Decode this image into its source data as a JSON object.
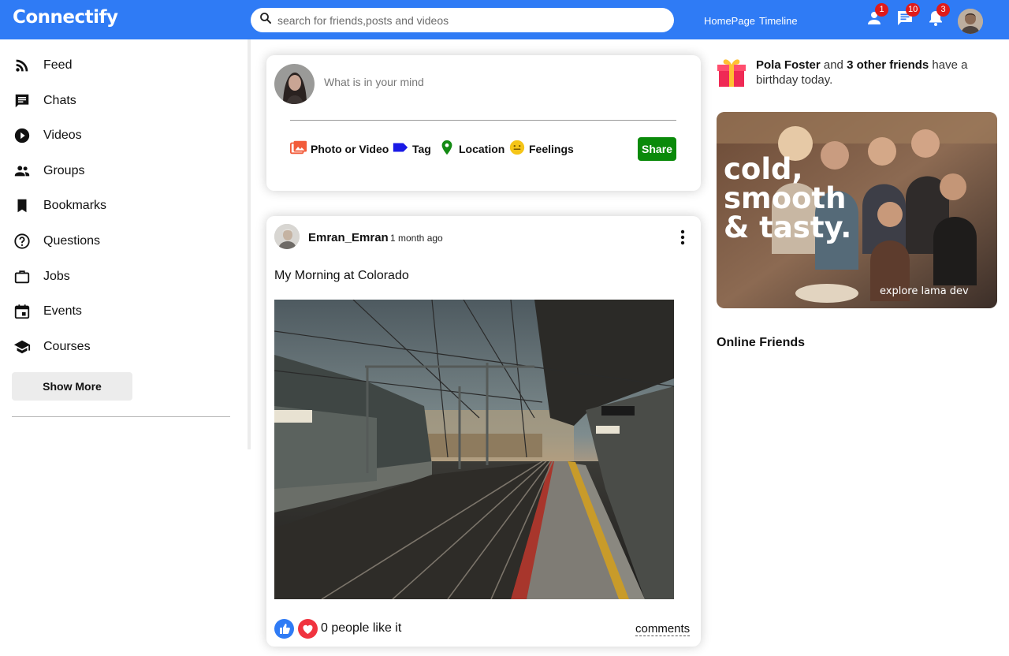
{
  "brand": {
    "logo_text": "Connectify",
    "accent_color": "#2f7bf5"
  },
  "search": {
    "placeholder": "search for friends,posts and videos",
    "icon": "search-icon"
  },
  "topbar": {
    "links": [
      "HomePage",
      "Timeline"
    ],
    "icons": [
      {
        "icon": "person-icon",
        "badge": "1"
      },
      {
        "icon": "chat-icon",
        "badge": "10"
      },
      {
        "icon": "bell-icon",
        "badge": "3"
      }
    ],
    "badge_color": "#e01a1a"
  },
  "sidebar": {
    "items": [
      {
        "label": "Feed",
        "icon": "rss-feed-icon"
      },
      {
        "label": "Chats",
        "icon": "chat-icon"
      },
      {
        "label": "Videos",
        "icon": "play-circle-icon"
      },
      {
        "label": "Groups",
        "icon": "group-icon"
      },
      {
        "label": "Bookmarks",
        "icon": "bookmark-icon"
      },
      {
        "label": "Questions",
        "icon": "help-circle-icon"
      },
      {
        "label": "Jobs",
        "icon": "briefcase-icon"
      },
      {
        "label": "Events",
        "icon": "calendar-icon"
      },
      {
        "label": "Courses",
        "icon": "school-icon"
      }
    ],
    "show_more": "Show More"
  },
  "share": {
    "placeholder": "What is in your mind",
    "options": [
      {
        "label": "Photo or Video",
        "icon": "photo-icon",
        "color": "#f25c3b"
      },
      {
        "label": "Tag",
        "icon": "label-icon",
        "color": "#1a1ae6"
      },
      {
        "label": "Location",
        "icon": "location-pin-icon",
        "color": "#138a13"
      },
      {
        "label": "Feelings",
        "icon": "smiley-icon",
        "color": "#f5c518"
      }
    ],
    "button": "Share",
    "button_color": "#0a8a0a"
  },
  "post": {
    "username": "Emran_Emran",
    "time": "1 month ago",
    "text": "My Morning at Colorado",
    "likes_text": "0 people like it",
    "comments_label": "comments"
  },
  "rightbar": {
    "birthday": {
      "name": "Pola Foster",
      "connector": " and ",
      "others": "3 other friends",
      "suffix": " have a birthday today."
    },
    "ad": {
      "headline_lines": [
        "cold,",
        "smooth",
        "& tasty."
      ],
      "tagline": "explore lama dev"
    },
    "online_title": "Online Friends"
  }
}
